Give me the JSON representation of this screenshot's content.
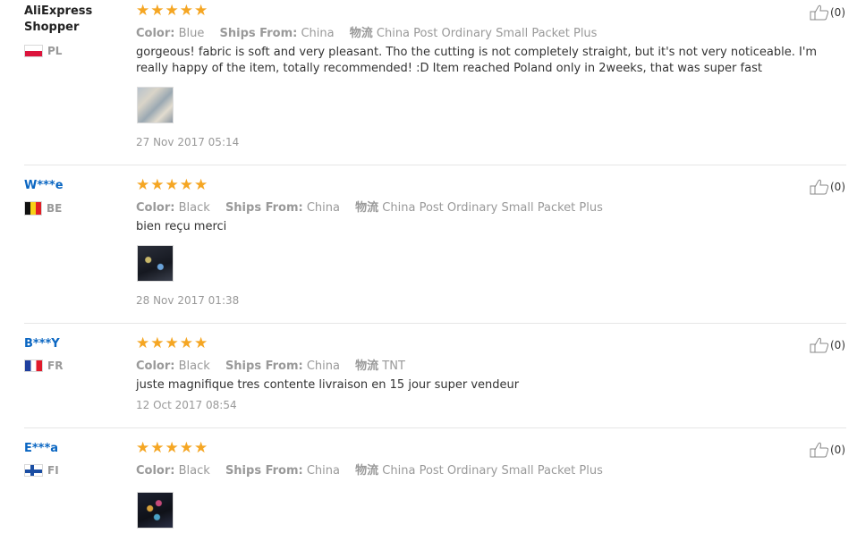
{
  "labels": {
    "color": "Color:",
    "ships_from": "Ships From:",
    "logistics": "物流"
  },
  "reviews": [
    {
      "user": "AliExpress Shopper",
      "country": "PL",
      "flag": "pl",
      "stars": 5,
      "color": "Blue",
      "ships_from": "China",
      "logistics": "China Post Ordinary Small Packet Plus",
      "text": "gorgeous! fabric is soft and very pleasant. Tho the cutting is not completely straight, but it's not very noticeable. I'm really happy of the item, totally recommended! :D Item reached Poland only in 2weeks, that was super fast",
      "date": "27 Nov 2017 05:14",
      "likes": "(0)",
      "has_photo": true
    },
    {
      "user": "W***e",
      "country": "BE",
      "flag": "be",
      "stars": 5,
      "color": "Black",
      "ships_from": "China",
      "logistics": "China Post Ordinary Small Packet Plus",
      "text": "bien reçu merci",
      "date": "28 Nov 2017 01:38",
      "likes": "(0)",
      "has_photo": true
    },
    {
      "user": "B***Y",
      "country": "FR",
      "flag": "fr",
      "stars": 5,
      "color": "Black",
      "ships_from": "China",
      "logistics": "TNT",
      "text": "juste magnifique tres contente livraison en 15 jour super vendeur",
      "date": "12 Oct 2017 08:54",
      "likes": "(0)",
      "has_photo": false
    },
    {
      "user": "E***a",
      "country": "FI",
      "flag": "fi",
      "stars": 5,
      "color": "Black",
      "ships_from": "China",
      "logistics": "China Post Ordinary Small Packet Plus",
      "text": "",
      "date": "",
      "likes": "(0)",
      "has_photo": true
    }
  ],
  "colors": {
    "star": "#f5a623",
    "username_link": "#0a66c2",
    "muted": "#999999"
  },
  "icons": {
    "star": "star-icon",
    "like": "thumbs-up-icon"
  }
}
